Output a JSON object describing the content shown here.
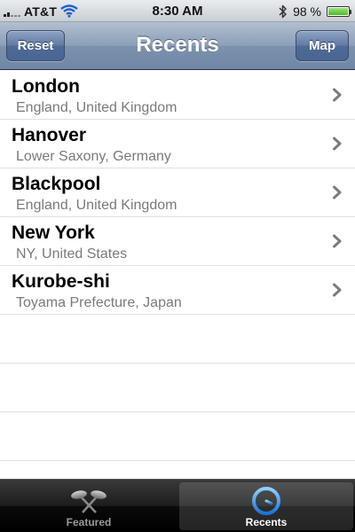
{
  "status_bar": {
    "carrier": "AT&T",
    "time": "8:30 AM",
    "battery_percent_label": "98 %",
    "battery_level": 0.98,
    "icons": [
      "signal-icon",
      "wifi-icon",
      "bluetooth-icon",
      "battery-icon"
    ]
  },
  "nav_bar": {
    "title": "Recents",
    "reset_label": "Reset",
    "map_label": "Map"
  },
  "recents": [
    {
      "name": "London",
      "region": "England, United Kingdom"
    },
    {
      "name": "Hanover",
      "region": "Lower Saxony, Germany"
    },
    {
      "name": "Blackpool",
      "region": "England, United Kingdom"
    },
    {
      "name": "New York",
      "region": "NY, United States"
    },
    {
      "name": "Kurobe-shi",
      "region": "Toyama Prefecture, Japan"
    }
  ],
  "tab_bar": {
    "tabs": [
      {
        "label": "Featured",
        "icon": "featured-icon",
        "selected": false
      },
      {
        "label": "Recents",
        "icon": "clock-icon",
        "selected": true
      }
    ]
  },
  "colors": {
    "nav_bar": "#7b91ad",
    "nav_button": "#4e6a96",
    "subtitle_text": "#7a7a7a",
    "separator": "#e0e0e0",
    "tab_selected_icon": "#2f8ff0"
  }
}
